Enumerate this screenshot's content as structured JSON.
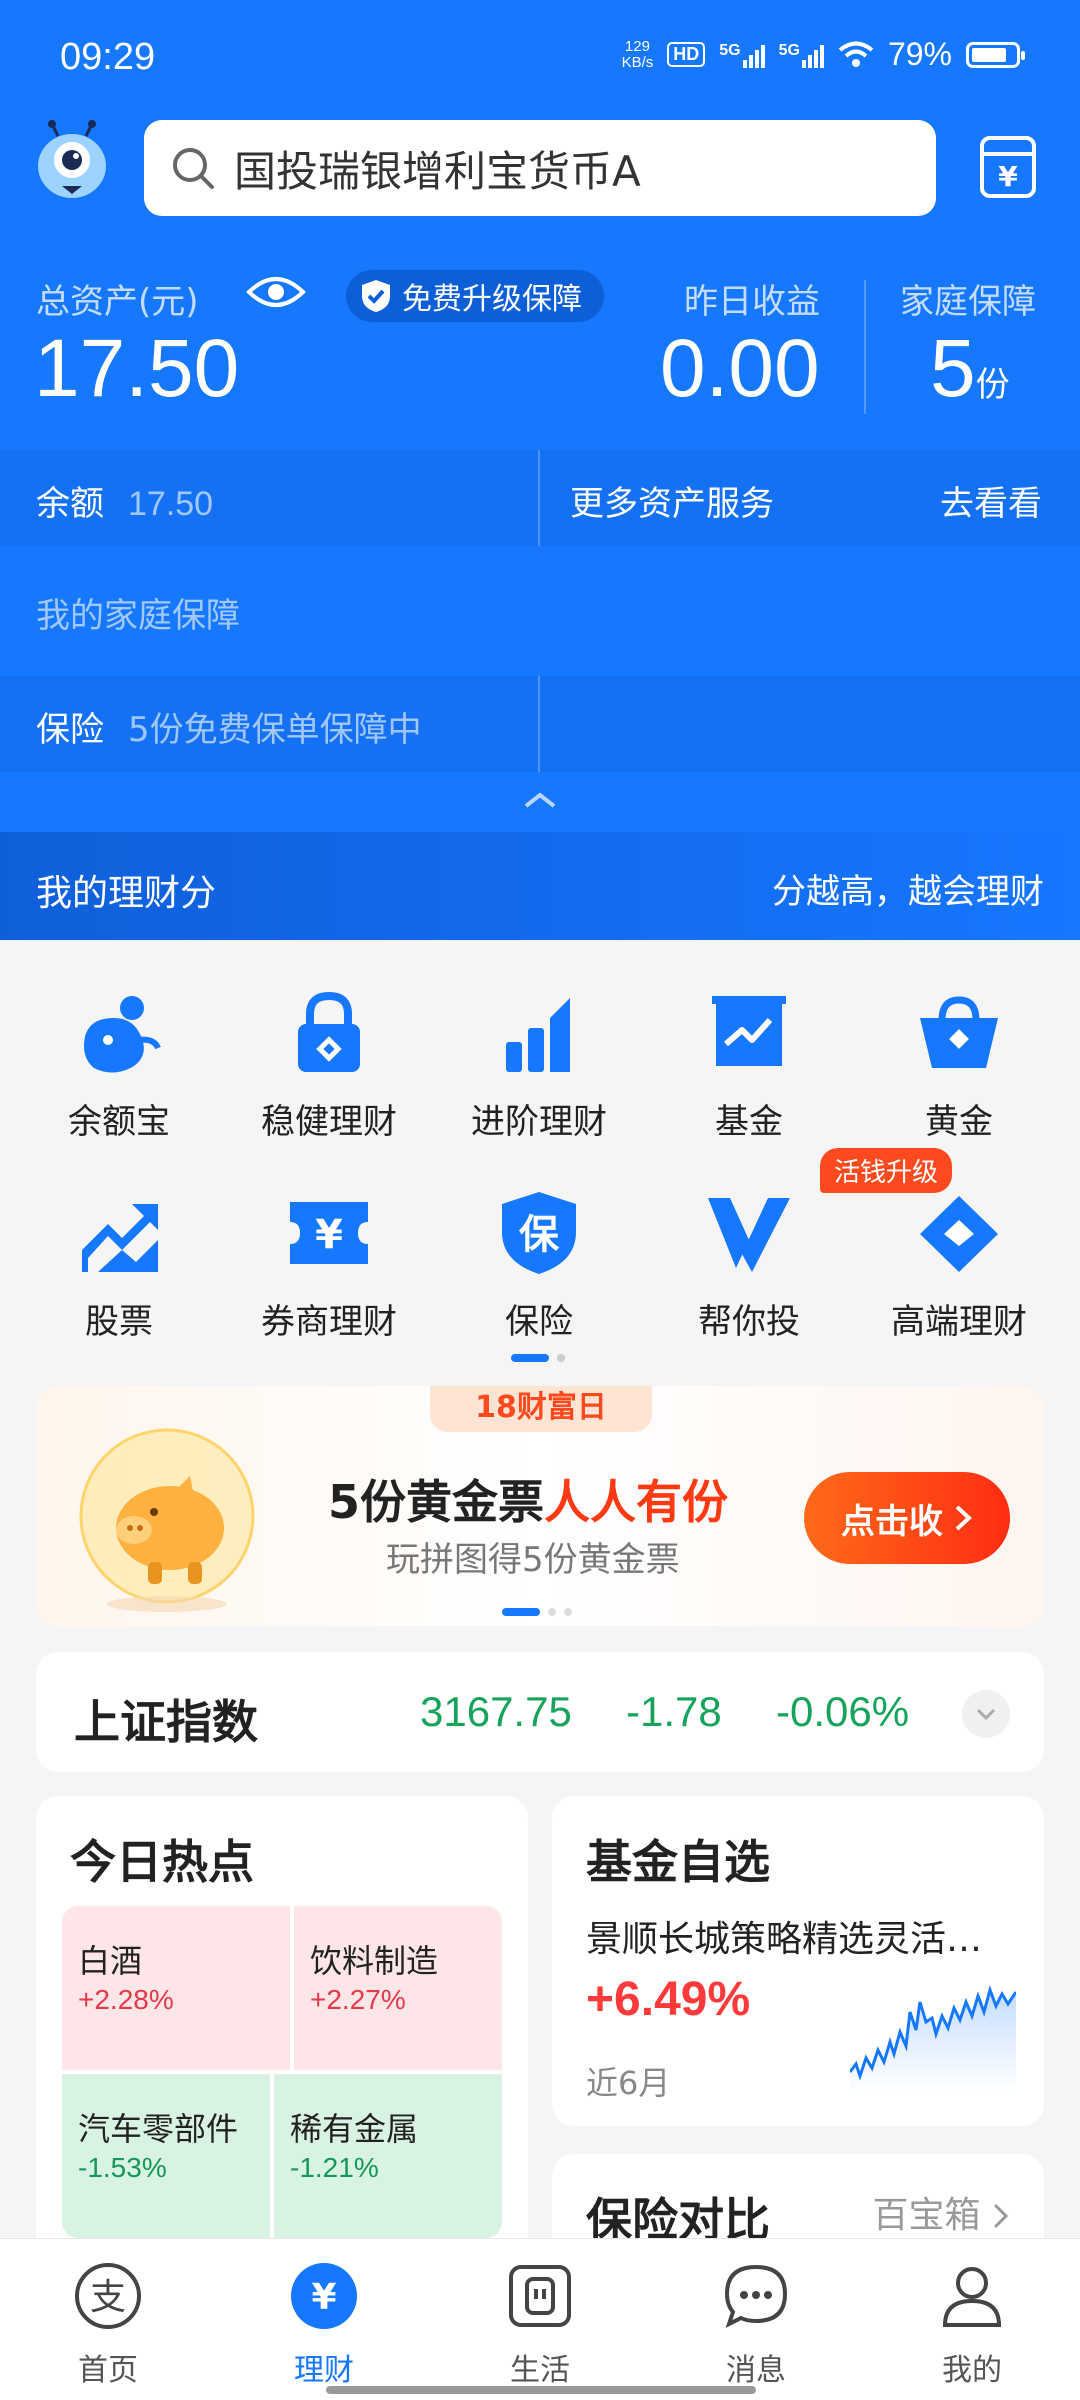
{
  "status_bar": {
    "time": "09:29",
    "speed_value": "129",
    "speed_unit": "KB/s",
    "net_badge": "HD",
    "sim1": "5G",
    "sim2": "5G",
    "battery": "79%"
  },
  "search": {
    "text": "国投瑞银增利宝货币A"
  },
  "assets": {
    "total_label": "总资产(元)",
    "total_value": "17.50",
    "badge_label": "免费升级保障",
    "yesterday_label": "昨日收益",
    "yesterday_value": "0.00",
    "family_label": "家庭保障",
    "family_value": "5",
    "family_unit": "份"
  },
  "balance_row": {
    "label": "余额",
    "value": "17.50",
    "more_label": "更多资产服务",
    "go_label": "去看看"
  },
  "family_section": {
    "title": "我的家庭保障",
    "ins_label": "保险",
    "ins_value": "5份免费保单保障中"
  },
  "score_bar": {
    "left": "我的理财分",
    "right": "分越高，越会理财"
  },
  "grid": {
    "items": [
      {
        "label": "余额宝",
        "icon": "yuebao-icon"
      },
      {
        "label": "稳健理财",
        "icon": "lock-icon"
      },
      {
        "label": "进阶理财",
        "icon": "bar-chart-icon"
      },
      {
        "label": "基金",
        "icon": "fund-chart-icon"
      },
      {
        "label": "黄金",
        "icon": "gold-basket-icon"
      },
      {
        "label": "股票",
        "icon": "stock-trend-icon"
      },
      {
        "label": "券商理财",
        "icon": "yen-ticket-icon"
      },
      {
        "label": "保险",
        "icon": "shield-icon"
      },
      {
        "label": "帮你投",
        "icon": "v-logo-icon"
      },
      {
        "label": "高端理财",
        "icon": "diamond-icon"
      }
    ],
    "hot_tag": "活钱升级"
  },
  "banner": {
    "tag": "18财富日",
    "headline_a": "5份黄金票",
    "headline_b": "人人有份",
    "sub": "玩拼图得5份黄金票",
    "button": "点击收"
  },
  "index": {
    "name": "上证指数",
    "value": "3167.75",
    "change": "-1.78",
    "percent": "-0.06%"
  },
  "hot": {
    "title": "今日热点",
    "tiles": [
      {
        "name": "白酒",
        "pct": "+2.28%"
      },
      {
        "name": "饮料制造",
        "pct": "+2.27%"
      },
      {
        "name": "汽车零部件",
        "pct": "-1.53%"
      },
      {
        "name": "稀有金属",
        "pct": "-1.21%"
      }
    ]
  },
  "fund": {
    "title": "基金自选",
    "name": "景顺长城策略精选灵活…",
    "pct": "+6.49%",
    "period": "近6月"
  },
  "insurance": {
    "title": "保险对比",
    "more": "百宝箱"
  },
  "tabs": [
    {
      "label": "首页",
      "icon": "alipay-icon"
    },
    {
      "label": "理财",
      "icon": "yen-circle-icon"
    },
    {
      "label": "生活",
      "icon": "life-icon"
    },
    {
      "label": "消息",
      "icon": "chat-bubble-icon"
    },
    {
      "label": "我的",
      "icon": "person-icon"
    }
  ],
  "colors": {
    "brand": "#1677ff",
    "up": "#ff3a3a",
    "down": "#16a35c",
    "accent": "#ff4a1f"
  }
}
